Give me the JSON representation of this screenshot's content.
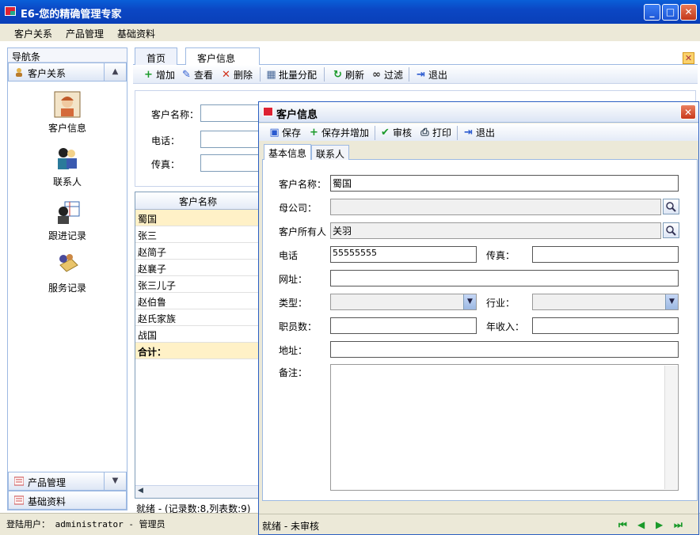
{
  "window": {
    "title": "E6-您的精确管理专家"
  },
  "menu": [
    "客户关系",
    "产品管理",
    "基础资料"
  ],
  "nav": {
    "header": "导航条",
    "group_active": "客户关系",
    "items": [
      "客户信息",
      "联系人",
      "跟进记录",
      "服务记录"
    ],
    "groups_bottom": [
      "产品管理",
      "基础资料"
    ]
  },
  "tabs": [
    "首页",
    "客户信息"
  ],
  "toolbar": {
    "add": "增加",
    "view": "查看",
    "delete": "删除",
    "batch": "批量分配",
    "refresh": "刷新",
    "filter": "过滤",
    "exit": "退出"
  },
  "search_form": {
    "name_label": "客户名称：",
    "phone_label": "电话：",
    "fax_label": "传真："
  },
  "grid": {
    "header": "客户名称",
    "rows": [
      "蜀国",
      "张三",
      "赵简子",
      "赵襄子",
      "张三儿子",
      "赵伯鲁",
      "赵氏家族",
      "战国"
    ],
    "total_label": "合计："
  },
  "status_left": "就绪 - (记录数:8,列表数:9)",
  "login": {
    "text": "登陆用户： administrator - 管理员"
  },
  "dialog": {
    "title": "客户信息",
    "toolbar": {
      "save": "保存",
      "save_add": "保存并增加",
      "approve": "审核",
      "print": "打印",
      "exit": "退出"
    },
    "tabs": [
      "基本信息",
      "联系人"
    ],
    "labels": {
      "name": "客户名称：",
      "parent": "母公司：",
      "owner": "客户所有人",
      "phone": "电话",
      "fax": "传真：",
      "web": "网址：",
      "type": "类型：",
      "industry": "行业：",
      "staff": "职员数：",
      "income": "年收入：",
      "address": "地址：",
      "note": "备注："
    },
    "values": {
      "name": "蜀国",
      "parent": "",
      "owner": "关羽",
      "phone": "55555555",
      "fax": "",
      "web": "",
      "type": "",
      "industry": "",
      "staff": "",
      "income": "",
      "address": "",
      "note": ""
    },
    "status": "就绪 - 未审核"
  }
}
